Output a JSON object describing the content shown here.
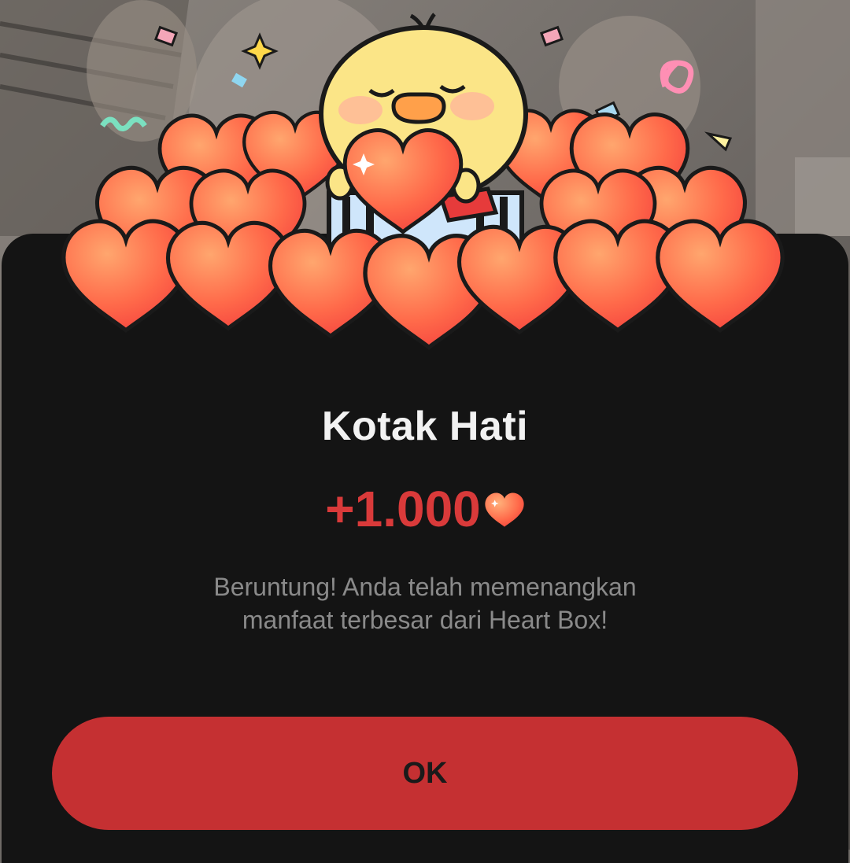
{
  "dialog": {
    "title": "Kotak Hati",
    "reward_amount": "+1.000",
    "message_line1": "Beruntung! Anda telah memenangkan",
    "message_line2": "manfaat terbesar dari Heart Box!",
    "ok_label": "OK"
  },
  "icons": {
    "reward": "heart-icon",
    "illustration": "duck-with-hearts-illustration"
  },
  "colors": {
    "sheet_background": "#141414",
    "accent": "#d93a3a",
    "button": "#c53032",
    "title": "#f2f2f2",
    "message": "#8a8a8a"
  }
}
